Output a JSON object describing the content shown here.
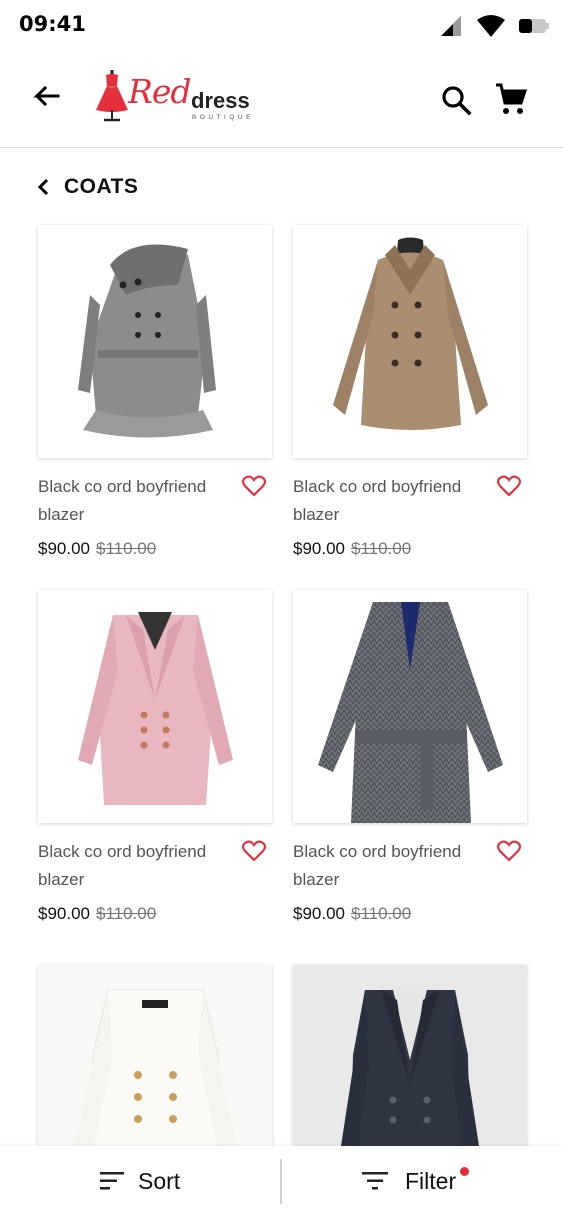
{
  "status_bar": {
    "time": "09:41",
    "icons": [
      "signal-icon",
      "wifi-icon",
      "battery-icon"
    ]
  },
  "app_bar": {
    "logo": {
      "part1": "Red",
      "part2": "dress",
      "tagline": "BOUTIQUE"
    },
    "icons": [
      "back-arrow-icon",
      "search-icon",
      "cart-icon"
    ]
  },
  "section": {
    "title": "COATS"
  },
  "products": [
    {
      "name": "Black co ord  boyfriend blazer",
      "price": "$90.00",
      "old_price": "$110.00"
    },
    {
      "name": "Black co ord  boyfriend blazer",
      "price": "$90.00",
      "old_price": "$110.00"
    },
    {
      "name": "Black co ord  boyfriend blazer",
      "price": "$90.00",
      "old_price": "$110.00"
    },
    {
      "name": "Black co ord  boyfriend blazer",
      "price": "$90.00",
      "old_price": "$110.00"
    },
    {
      "name": "",
      "price": "",
      "old_price": ""
    },
    {
      "name": "",
      "price": "",
      "old_price": ""
    }
  ],
  "bottom_bar": {
    "sort_label": "Sort",
    "filter_label": "Filter",
    "filter_active": true
  },
  "colors": {
    "accent": "#e4303d",
    "text": "#111111",
    "muted": "#555555"
  }
}
